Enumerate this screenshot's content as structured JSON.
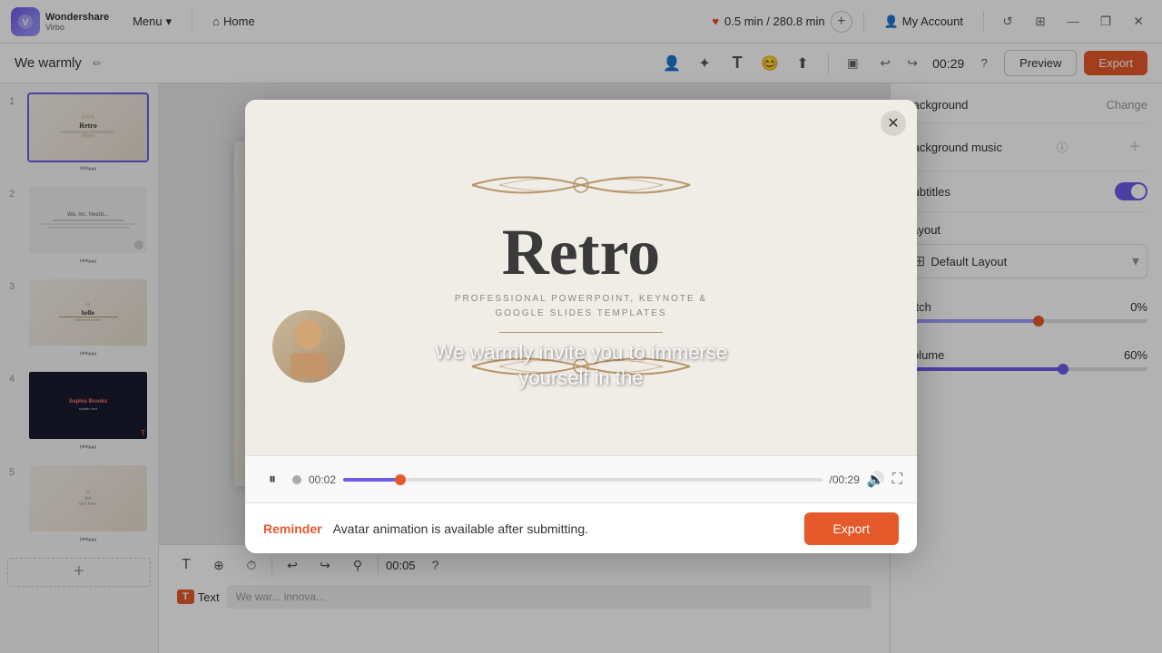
{
  "app": {
    "name": "Wondershare",
    "sub": "Virbo"
  },
  "topbar": {
    "menu_label": "Menu",
    "home_label": "Home",
    "time_info": "0.5 min / 280.8 min",
    "my_account": "My Account",
    "window_controls": {
      "minimize": "—",
      "maximize": "❐",
      "close": "✕"
    }
  },
  "secondbar": {
    "project_title": "We warmly",
    "timer": "00:29",
    "preview_label": "Preview",
    "export_label": "Export"
  },
  "slides": [
    {
      "num": "1",
      "type": "retro",
      "active": true
    },
    {
      "num": "2",
      "type": "light"
    },
    {
      "num": "3",
      "type": "retro"
    },
    {
      "num": "4",
      "type": "dark"
    },
    {
      "num": "5",
      "type": "retro"
    }
  ],
  "right_panel": {
    "background_label": "Background",
    "change_label": "Change",
    "bg_music_label": "Background music",
    "subtitles_label": "Subtitles",
    "layout_label": "Layout",
    "default_layout": "Default Layout",
    "pitch_label": "Pitch",
    "pitch_value": "0%",
    "volume_label": "Volume",
    "volume_value": "60%",
    "pitch_percent": 55,
    "volume_percent": 65
  },
  "bottom_panel": {
    "time_display": "00:05",
    "text_badge": "T",
    "text_label": "Text",
    "text_content": "We war... innova..."
  },
  "modal": {
    "retro_title": "Retro",
    "retro_subtitle": "PROFESSIONAL POWERPOINT, KEYNOTE &\nGOOGLE SLIDES TEMPLATES",
    "subtitle_line1": "We warmly invite you to immerse",
    "subtitle_line2": "yourself in the",
    "time_current": "00:02",
    "time_total": "00:29",
    "reminder_label": "Reminder",
    "reminder_text": "Avatar animation is available after submitting.",
    "export_label": "Export",
    "progress_percent": 12
  }
}
